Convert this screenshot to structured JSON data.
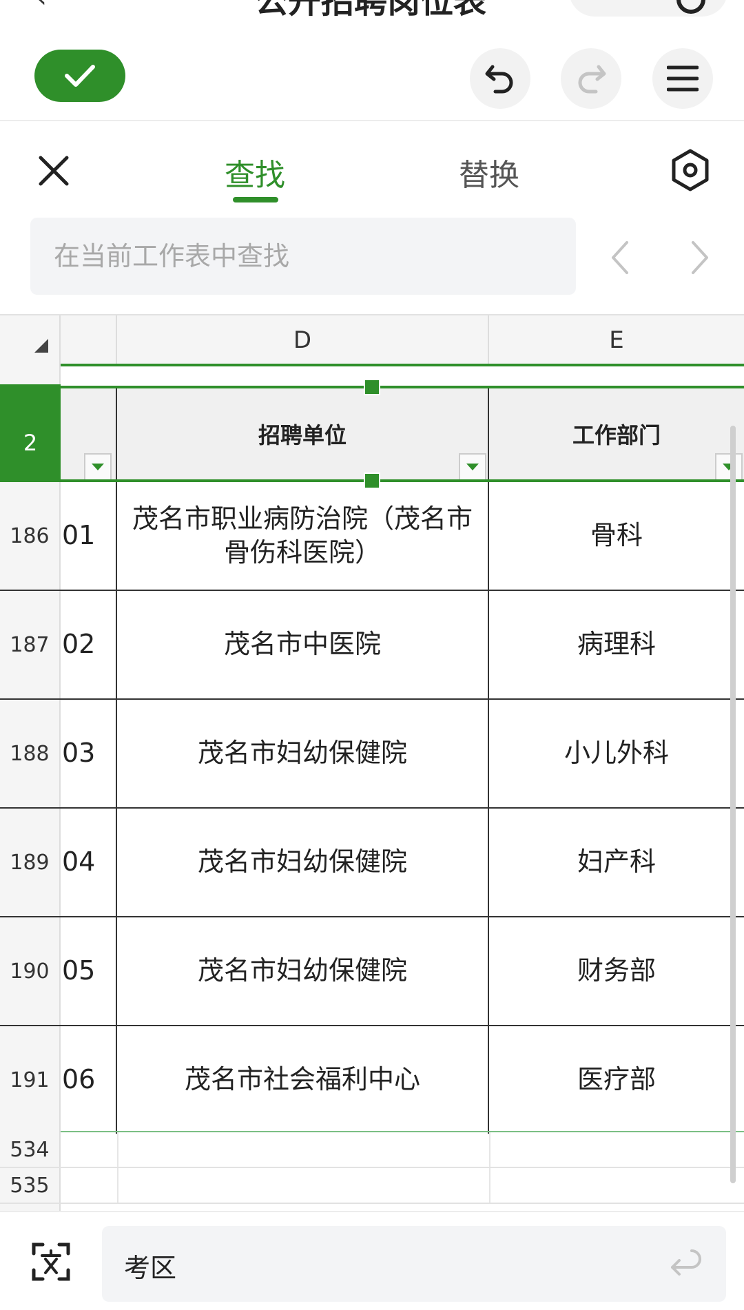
{
  "window": {
    "title": "公开招聘岗位表"
  },
  "toolbar": {
    "confirm_icon": "check-icon",
    "undo_icon": "undo-icon",
    "redo_icon": "redo-icon",
    "menu_icon": "menu-icon"
  },
  "find_panel": {
    "tabs": [
      {
        "label": "查找",
        "active": true
      },
      {
        "label": "替换",
        "active": false
      }
    ],
    "search": {
      "value": "",
      "placeholder": "在当前工作表中查找"
    }
  },
  "sheet": {
    "columns": [
      "D",
      "E"
    ],
    "selected_row": "2",
    "header_row": {
      "c": "",
      "d": "招聘单位",
      "e": "工作部门"
    },
    "rows": [
      {
        "num": "186",
        "c": "01",
        "d": "茂名市职业病防治院（茂名市骨伤科医院）",
        "e": "骨科"
      },
      {
        "num": "187",
        "c": "02",
        "d": "茂名市中医院",
        "e": "病理科"
      },
      {
        "num": "188",
        "c": "03",
        "d": "茂名市妇幼保健院",
        "e": "小儿外科"
      },
      {
        "num": "189",
        "c": "04",
        "d": "茂名市妇幼保健院",
        "e": "妇产科"
      },
      {
        "num": "190",
        "c": "05",
        "d": "茂名市妇幼保健院",
        "e": "财务部"
      },
      {
        "num": "191",
        "c": "06",
        "d": "茂名市社会福利中心",
        "e": "医疗部"
      }
    ],
    "empty_rows": [
      "534",
      "535"
    ]
  },
  "formula_bar": {
    "value": "考区"
  },
  "colors": {
    "accent": "#2f8f2a"
  }
}
